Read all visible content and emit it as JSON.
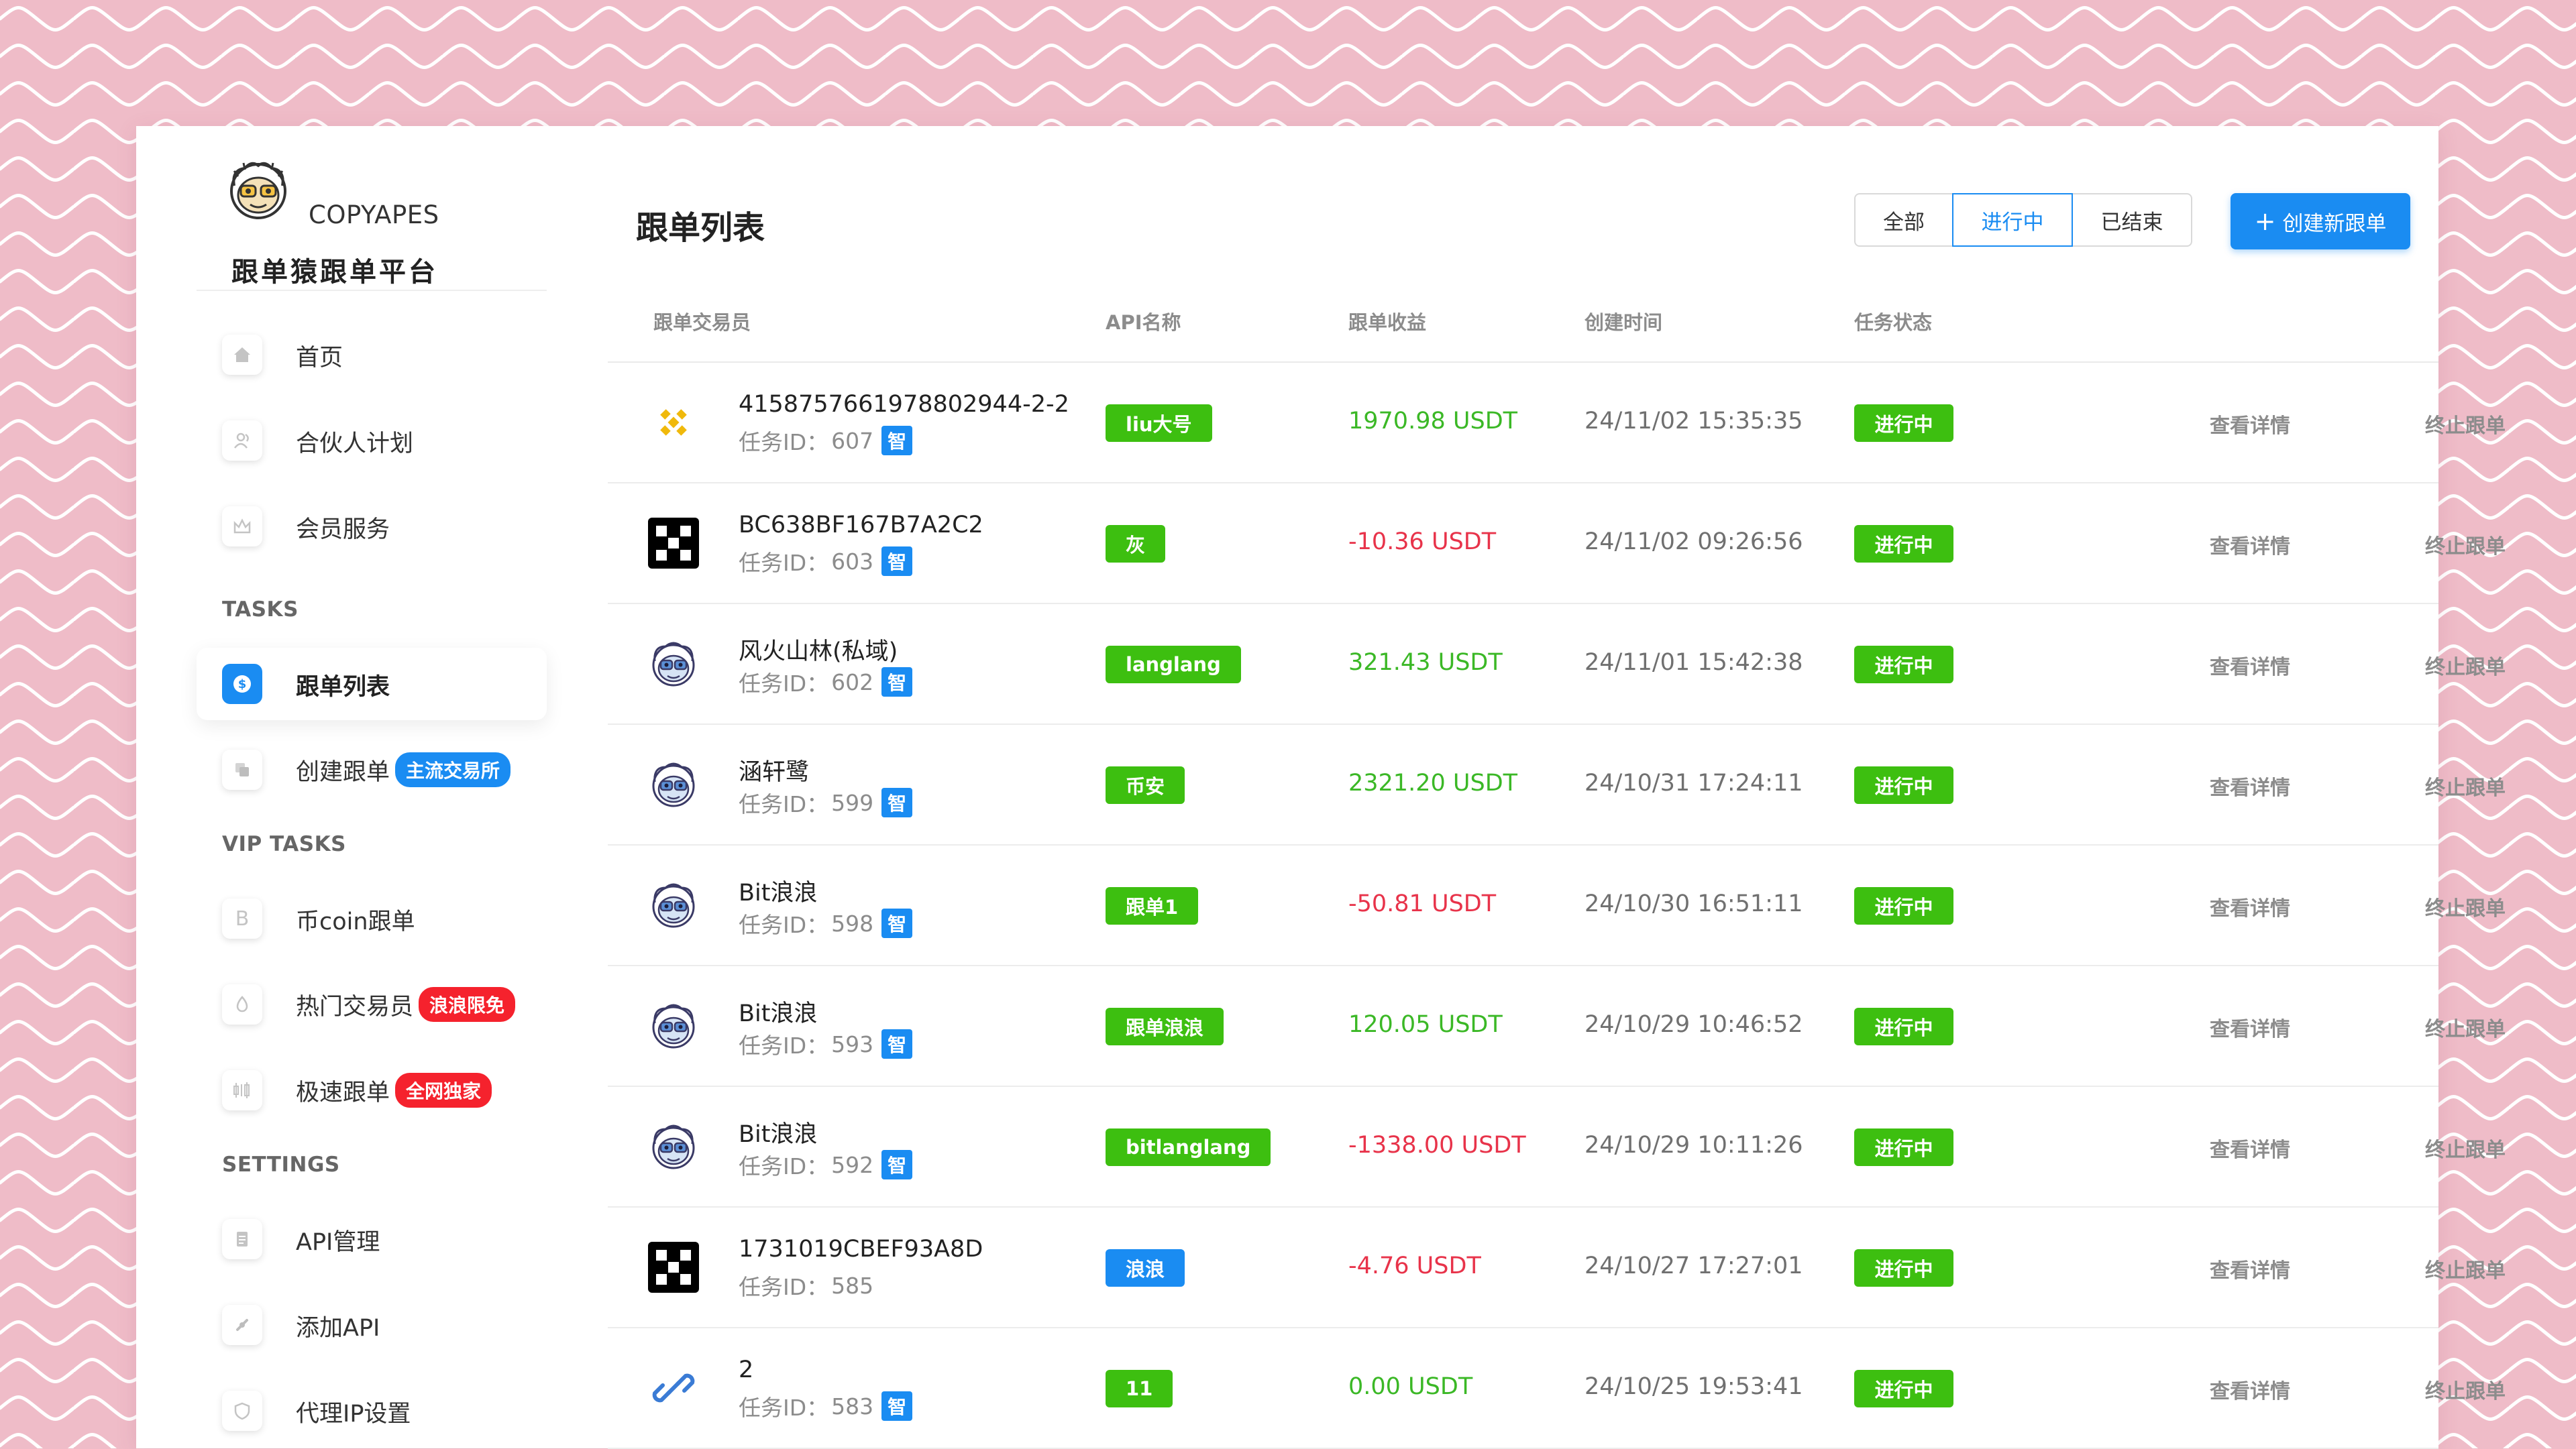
{
  "colors": {
    "background": "#efbcc8",
    "wave": "#ffffff",
    "accent": "#1a8cf2",
    "positive": "#3bb826",
    "negative": "#e8334a",
    "status_running": "#3dbf10",
    "badge_red": "#f5222d"
  },
  "brand": {
    "name": "COPYAPES",
    "title": "跟单猿跟单平台"
  },
  "sidebar": {
    "items_top": [
      {
        "label": "首页",
        "icon": "home-icon",
        "glyph": "⌂"
      },
      {
        "label": "合伙人计划",
        "icon": "partner-icon",
        "glyph": "♙"
      },
      {
        "label": "会员服务",
        "icon": "member-icon",
        "glyph": "♔"
      }
    ],
    "section_tasks": "TASKS",
    "tasks": [
      {
        "label": "跟单列表",
        "icon": "dollar-icon",
        "glyph": "$",
        "active": true
      },
      {
        "label": "创建跟单",
        "icon": "copy-icon",
        "glyph": "❐",
        "badge": "主流交易所",
        "badge_color": "blue"
      }
    ],
    "section_vip": "VIP TASKS",
    "vip": [
      {
        "label": "币coin跟单",
        "icon": "coin-b-icon",
        "glyph": "B"
      },
      {
        "label": "热门交易员",
        "icon": "fire-icon",
        "glyph": "♨",
        "badge": "浪浪限免",
        "badge_color": "red"
      },
      {
        "label": "极速跟单",
        "icon": "speed-icon",
        "glyph": "⫴",
        "badge": "全网独家",
        "badge_color": "red"
      }
    ],
    "section_settings": "SETTINGS",
    "settings": [
      {
        "label": "API管理",
        "icon": "api-doc-icon",
        "glyph": "☰"
      },
      {
        "label": "添加API",
        "icon": "plug-icon",
        "glyph": "⚡"
      },
      {
        "label": "代理IP设置",
        "icon": "proxy-icon",
        "glyph": "⛉"
      }
    ]
  },
  "main": {
    "title": "跟单列表",
    "filters": [
      "全部",
      "进行中",
      "已结束"
    ],
    "active_filter": 1,
    "create_button": "创建新跟单",
    "columns": [
      "跟单交易员",
      "API名称",
      "跟单收益",
      "创建时间",
      "任务状态"
    ],
    "task_id_label": "任务ID：",
    "smart_tag": "智",
    "detail_label": "查看详情",
    "stop_label": "终止跟单",
    "rows": [
      {
        "icon": "binance-logo-icon",
        "name": "4158757661978802944-2-2",
        "task_id": "607",
        "smart": true,
        "api": "liu大号",
        "api_color": "#3dbf10",
        "profit": "1970.98 USDT",
        "profit_sign": "positive",
        "created": "24/11/02 15:35:35",
        "status": "进行中"
      },
      {
        "icon": "okx-logo-icon",
        "name": "BC638BF167B7A2C2",
        "task_id": "603",
        "smart": true,
        "api": "灰",
        "api_color": "#3dbf10",
        "profit": "-10.36 USDT",
        "profit_sign": "negative",
        "created": "24/11/02 09:26:56",
        "status": "进行中"
      },
      {
        "icon": "monkey-avatar-icon",
        "name": "风火山林(私域)",
        "task_id": "602",
        "smart": true,
        "api": "langlang",
        "api_color": "#3dbf10",
        "profit": "321.43 USDT",
        "profit_sign": "positive",
        "created": "24/11/01 15:42:38",
        "status": "进行中"
      },
      {
        "icon": "monkey-avatar-icon",
        "name": "涵轩鹭",
        "task_id": "599",
        "smart": true,
        "api": "币安",
        "api_color": "#3dbf10",
        "profit": "2321.20 USDT",
        "profit_sign": "positive",
        "created": "24/10/31 17:24:11",
        "status": "进行中"
      },
      {
        "icon": "monkey-avatar-icon",
        "name": "Bit浪浪",
        "task_id": "598",
        "smart": true,
        "api": "跟单1",
        "api_color": "#3dbf10",
        "profit": "-50.81 USDT",
        "profit_sign": "negative",
        "created": "24/10/30 16:51:11",
        "status": "进行中"
      },
      {
        "icon": "monkey-avatar-icon",
        "name": "Bit浪浪",
        "task_id": "593",
        "smart": true,
        "api": "跟单浪浪",
        "api_color": "#3dbf10",
        "profit": "120.05 USDT",
        "profit_sign": "positive",
        "created": "24/10/29 10:46:52",
        "status": "进行中"
      },
      {
        "icon": "monkey-avatar-icon",
        "name": "Bit浪浪",
        "task_id": "592",
        "smart": true,
        "api": "bitlanglang",
        "api_color": "#3dbf10",
        "profit": "-1338.00 USDT",
        "profit_sign": "negative",
        "created": "24/10/29 10:11:26",
        "status": "进行中"
      },
      {
        "icon": "okx-logo-icon",
        "name": "1731019CBEF93A8D",
        "task_id": "585",
        "smart": false,
        "api": "浪浪",
        "api_color": "#1a8cf2",
        "profit": "-4.76 USDT",
        "profit_sign": "negative",
        "created": "24/10/27 17:27:01",
        "status": "进行中"
      },
      {
        "icon": "link-logo-icon",
        "name": "2",
        "task_id": "583",
        "smart": true,
        "api": "11",
        "api_color": "#3dbf10",
        "profit": "0.00 USDT",
        "profit_sign": "positive",
        "created": "24/10/25 19:53:41",
        "status": "进行中"
      }
    ]
  }
}
